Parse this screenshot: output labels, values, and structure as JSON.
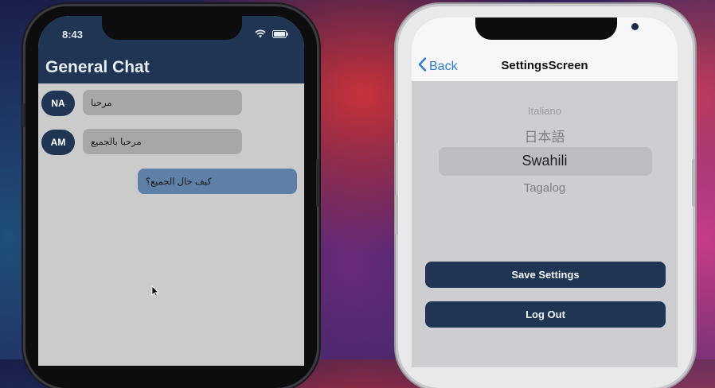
{
  "left_phone": {
    "status_time": "8:43",
    "header_title": "General Chat",
    "messages": [
      {
        "avatar": "NA",
        "text": "مرحبا",
        "direction": "incoming"
      },
      {
        "avatar": "AM",
        "text": "مرحبا بالجميع",
        "direction": "incoming"
      },
      {
        "text": "كيف حال الجميع؟",
        "direction": "outgoing"
      }
    ]
  },
  "right_phone": {
    "back_label": "Back",
    "nav_title": "SettingsScreen",
    "picker_items": [
      "Italiano",
      "日本語",
      "Swahili",
      "Tagalog"
    ],
    "selected_language": "Swahili",
    "save_button": "Save Settings",
    "logout_button": "Log Out"
  },
  "colors": {
    "header_navy": "#1f3553",
    "incoming_bubble": "#a7a7a7",
    "outgoing_bubble": "#5e7fa6",
    "ios_blue": "#2f7bd6"
  },
  "icons": [
    "wifi-icon",
    "battery-icon",
    "back-chevron-icon",
    "mouse-cursor-icon"
  ]
}
